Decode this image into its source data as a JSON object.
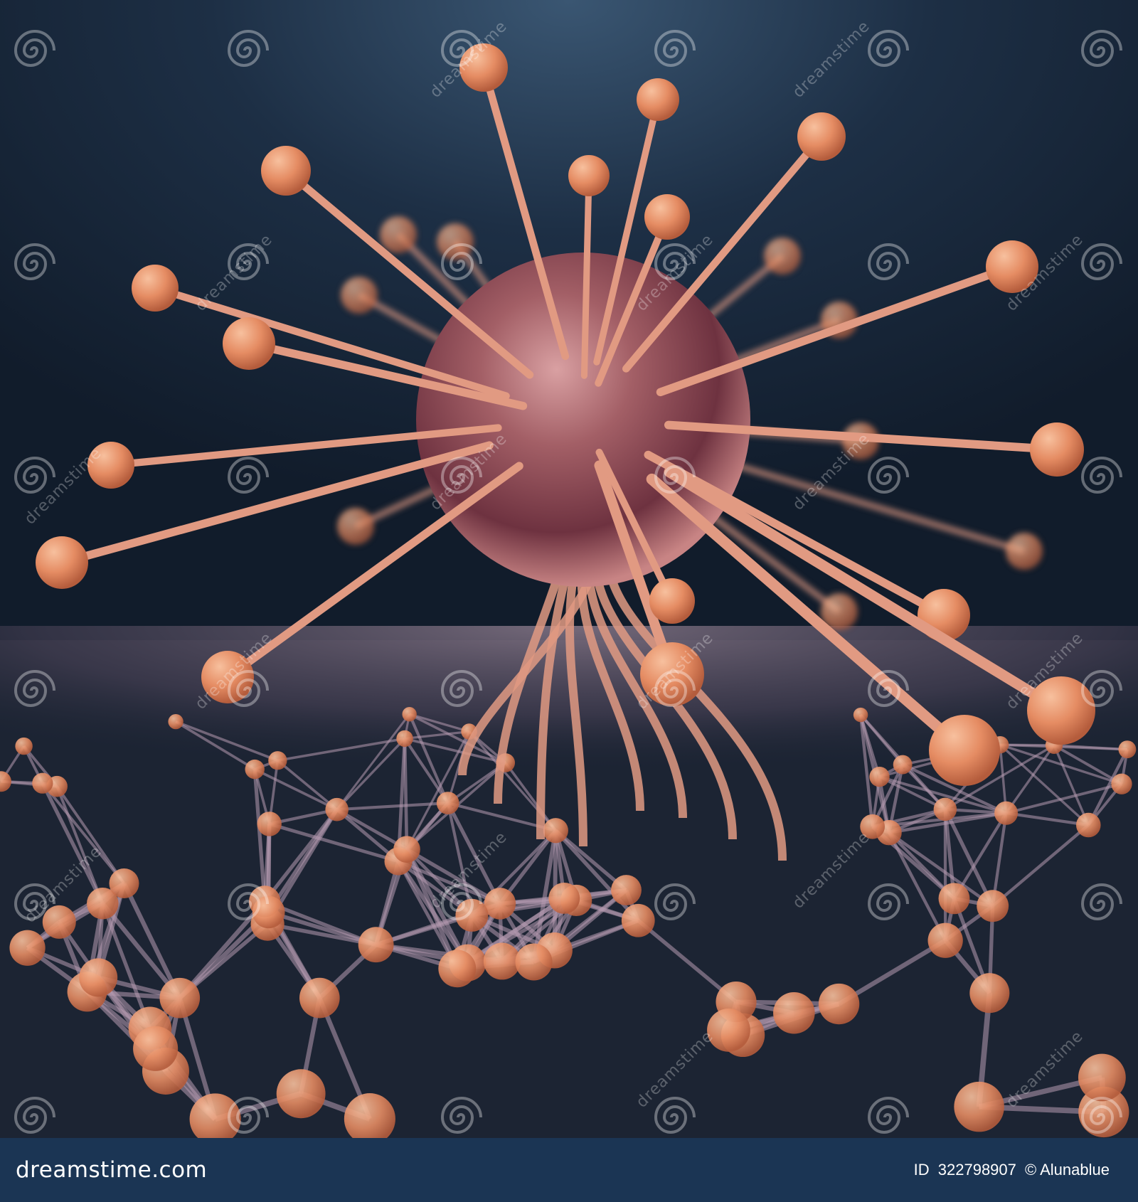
{
  "image": {
    "subject": "neuron-like cell",
    "colors": {
      "background_top": "#3a5672",
      "background_dark": "#111c2b",
      "cell_body": "#8a4a4f",
      "dendrite": "#e19a82",
      "node": "#e58c63",
      "footer": "#1b3554"
    }
  },
  "watermark": {
    "brand": "dreamstime",
    "icon": "dreamstime-swirl-icon"
  },
  "footer": {
    "logo_text": "dreamstime.com",
    "id_label": "ID",
    "id_value": "322798907",
    "credit": "© Alunablue"
  }
}
